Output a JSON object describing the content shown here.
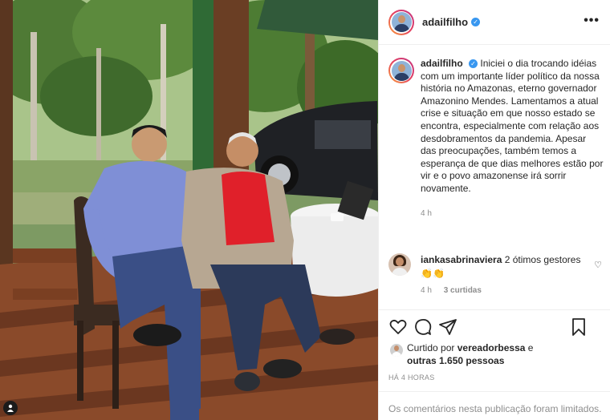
{
  "post": {
    "username": "adailfilho",
    "verified_icon": "verified-badge-icon",
    "more_icon": "more-options-icon",
    "more_glyph": "•••"
  },
  "caption": {
    "username": "adailfilho",
    "text": "Iniciei o dia trocando idéias com um importante líder político da nossa história no Amazonas, eterno governador Amazonino Mendes. Lamentamos a atual crise e situação em que nosso estado se encontra, especialmente com relação aos desdobramentos da pandemia. Apesar das preocupações, também temos a esperança de que dias melhores estão por vir e o povo amazonense irá sorrir novamente.",
    "time": "4 h"
  },
  "comment": {
    "username": "iankasabrinaviera",
    "text": "2 ótimos gestores 👏👏",
    "time": "4 h",
    "likes": "3 curtidas",
    "heart_glyph": "♡"
  },
  "actions": {
    "icons": [
      "heart-icon",
      "comment-icon",
      "share-icon",
      "bookmark-icon"
    ]
  },
  "likes": {
    "prefix": "Curtido por",
    "user": "vereadorbessa",
    "conjunction": "e",
    "others": "outras 1.650 pessoas"
  },
  "timestamp": "HÁ 4 HORAS",
  "footer": "Os comentários nesta publicação foram limitados.",
  "colors": {
    "verified": "#3897f0",
    "text": "#262626",
    "muted": "#8e8e8e",
    "divider": "#efefef"
  }
}
